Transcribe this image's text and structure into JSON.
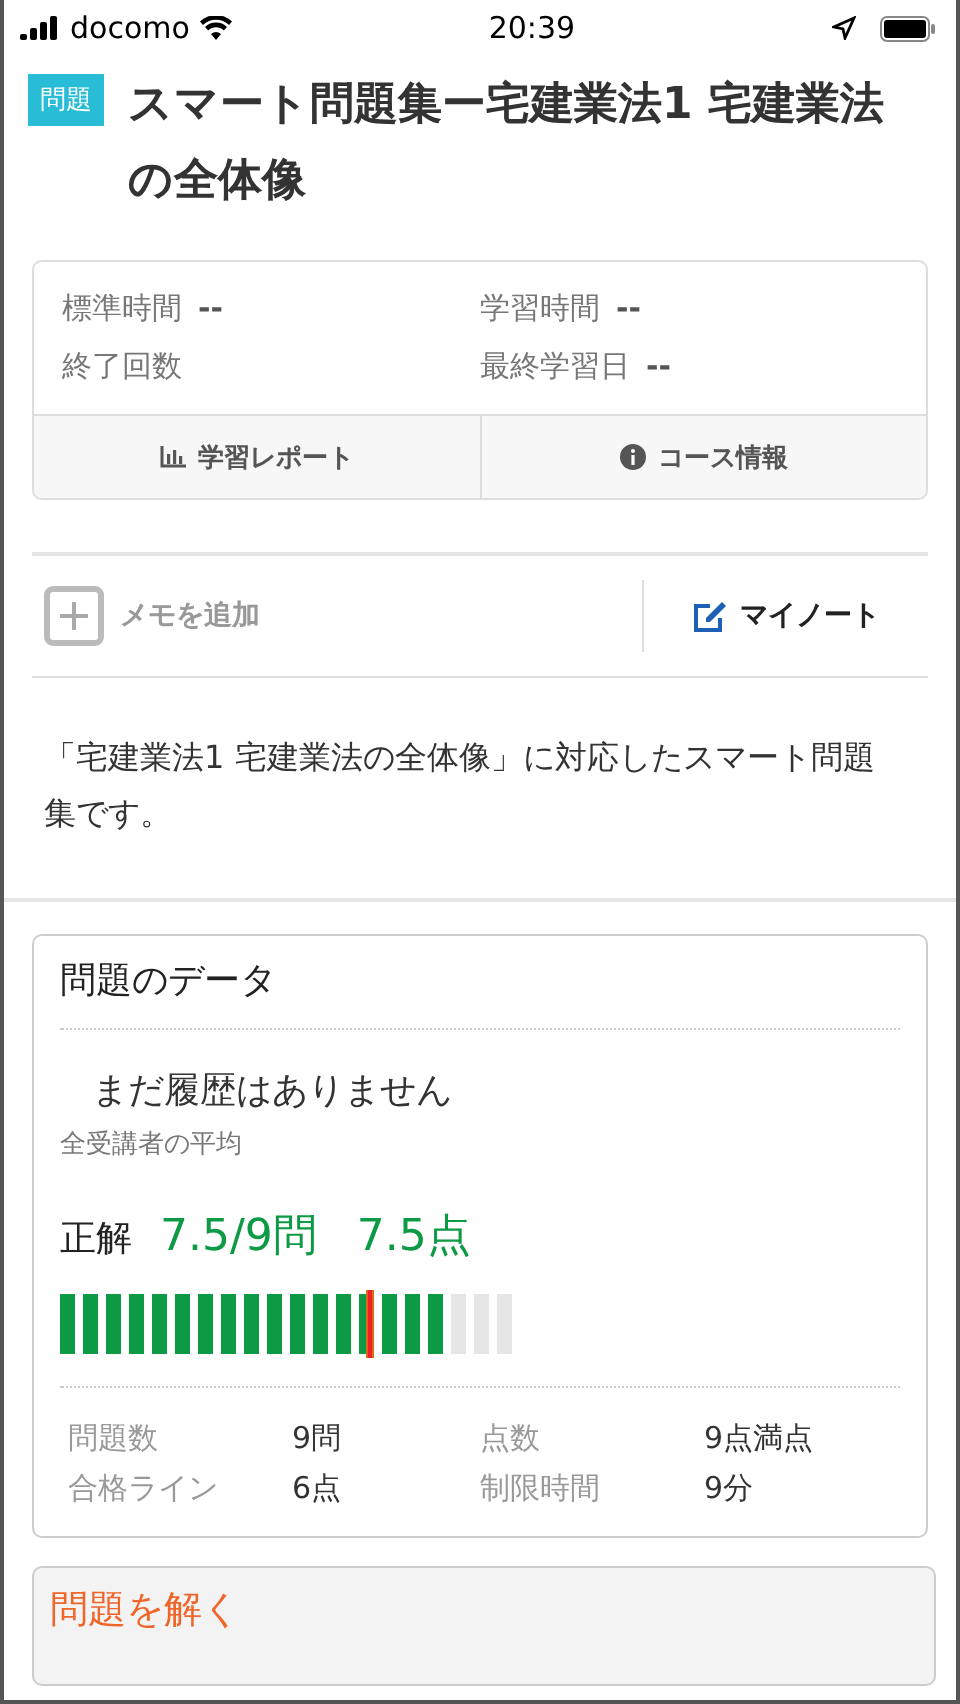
{
  "status_bar": {
    "carrier": "docomo",
    "time": "20:39"
  },
  "header": {
    "badge": "問題",
    "title": "スマート問題集ー宅建業法1 宅建業法の全体像"
  },
  "info": {
    "rows": [
      {
        "cells": [
          {
            "label": "標準時間",
            "value": "--"
          },
          {
            "label": "学習時間",
            "value": "--"
          }
        ]
      },
      {
        "cells": [
          {
            "label": "終了回数"
          },
          {
            "label": "最終学習日",
            "value": "--"
          }
        ]
      }
    ],
    "buttons": [
      {
        "kind": "report",
        "label": "学習レポート"
      },
      {
        "kind": "info",
        "label": "コース情報"
      }
    ]
  },
  "memo": {
    "add_label": "メモを追加",
    "note_label": "マイノート"
  },
  "description": "「宅建業法1 宅建業法の全体像」に対応したスマート問題集です。",
  "data_card": {
    "title": "問題のデータ",
    "history": "まだ履歴はありません",
    "average_label": "全受講者の平均",
    "correct_label": "正解",
    "correct_value": "7.5/9問",
    "score_value": "7.5点",
    "level": 0.833,
    "stats": [
      {
        "label": "問題数",
        "value": "9問"
      },
      {
        "label": "点数",
        "value": "9点満点"
      },
      {
        "label": "合格ライン",
        "value": "6点"
      },
      {
        "label": "制限時間",
        "value": "9分"
      }
    ]
  },
  "solve": {
    "title": "問題を解く"
  }
}
